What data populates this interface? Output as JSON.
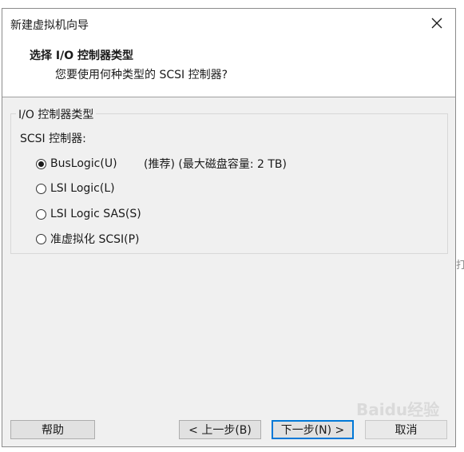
{
  "window": {
    "title": "新建虚拟机向导",
    "close_icon": "close-icon"
  },
  "header": {
    "title": "选择 I/O 控制器类型",
    "subtitle": "您要使用何种类型的 SCSI 控制器?"
  },
  "group": {
    "legend": "I/O 控制器类型",
    "label": "SCSI 控制器:",
    "options": [
      {
        "label": "BusLogic(U)",
        "checked": true
      },
      {
        "label": "LSI Logic(L)",
        "checked": false
      },
      {
        "label": "LSI Logic SAS(S)",
        "checked": false
      },
      {
        "label": "准虚拟化 SCSI(P)",
        "checked": false
      }
    ],
    "note": "(推荐) (最大磁盘容量: 2 TB)"
  },
  "buttons": {
    "help": "帮助",
    "back": "< 上一步(B)",
    "next": "下一步(N) >",
    "cancel": "取消"
  },
  "background": {
    "edge_text": "打"
  },
  "watermark": "Baidu经验"
}
